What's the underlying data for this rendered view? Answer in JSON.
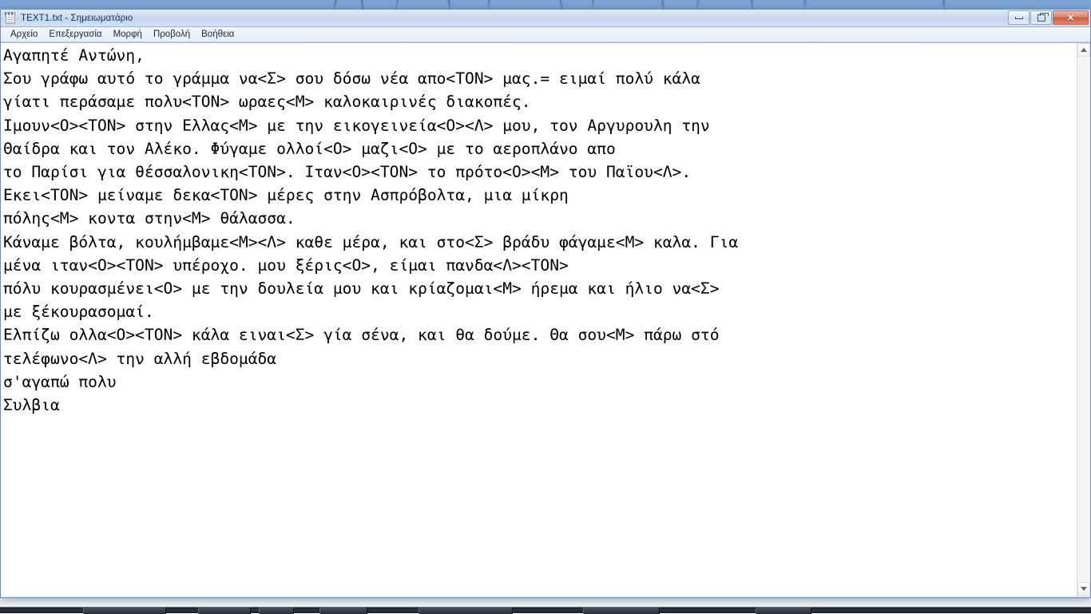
{
  "window": {
    "title": "TEXT1.txt - Σημειωματάριο",
    "app_icon": "notepad-icon",
    "caption": {
      "minimize_label": "Ελαχιστοποίηση",
      "restore_label": "Επαναφορά",
      "close_label": "✕"
    }
  },
  "menubar": {
    "items": [
      {
        "label": "Αρχείο",
        "name": "menu-file"
      },
      {
        "label": "Επεξεργασία",
        "name": "menu-edit"
      },
      {
        "label": "Μορφή",
        "name": "menu-format"
      },
      {
        "label": "Προβολή",
        "name": "menu-view"
      },
      {
        "label": "Βοήθεια",
        "name": "menu-help"
      }
    ]
  },
  "editor": {
    "content": "Αγαπητέ Αντώνη,\nΣου γράφω αυτό το γράμμα να<Σ> σου δόσω νέα απο<ΤΟΝ> μας.= ειμαί πολύ κάλα\nγίατι περάσαμε πολυ<ΤΟΝ> ωραες<Μ> καλοκαιρινές διακοπές.\nΙμουν<Ο><ΤΟΝ> στην Ελλας<Μ> με την εικογεινεία<Ο><Λ> μου, τον Αργυρουλη την\nΘαίδρα και τον Αλέκο. Φύγαμε ολλοί<Ο> μαζι<Ο> με το αεροπλάνο απο\nτο Παρίσι για θέσσαλονικη<ΤΟΝ>. Ιταν<Ο><ΤΟΝ> το πρότο<Ο><Μ> του Παϊου<Λ>.\nΕκει<ΤΟΝ> μείναμε δεκα<ΤΟΝ> μέρες στην Ασπρόβολτα, μια μίκρη\nπόλης<Μ> κοντα στην<Μ> θάλασσα.\nΚάναμε βόλτα, κουλήμβαμε<Μ><Λ> καθε μέρα, και στο<Σ> βράδυ φάγαμε<Μ> καλα. Για\nμένα ιταν<Ο><ΤΟΝ> υπέροχο. μου ξέρις<Ο>, είμαι πανδα<Λ><ΤΟΝ>\nπόλυ κουρασμένει<Ο> με την δουλεία μου και κρίαζομαι<Μ> ήρεμα και ήλιο να<Σ>\nμε ξέκουρασομαί.\nΕλπίζω ολλα<Ο><ΤΟΝ> κάλα ειναι<Σ> γία σένα, και θα δούμε. Θα σου<Μ> πάρω στό\nτελέφωνο<Λ> την αλλή εβδομάδα\nσ'αγαπώ πολυ\nΣυλβια",
    "placeholder": ""
  },
  "scrollbar": {
    "up_arrow": "scroll-up-icon",
    "down_arrow": "scroll-down-icon"
  },
  "colors": {
    "title_text": "#17324d",
    "close_button": "#cf5a3a",
    "text": "#000000",
    "editor_background": "#ffffff"
  }
}
